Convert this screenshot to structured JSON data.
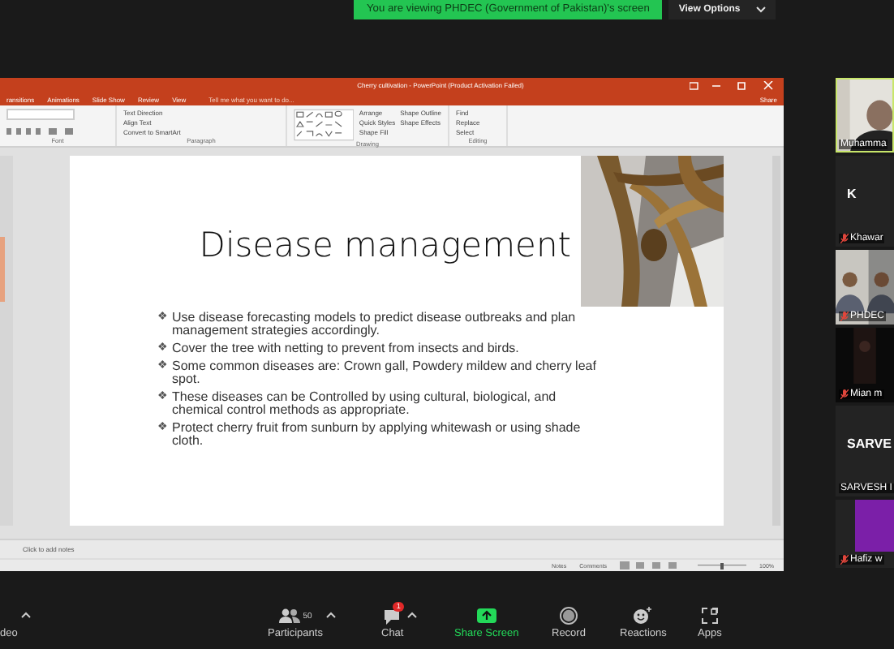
{
  "banner": {
    "text": "You are viewing PHDEC (Government of Pakistan)'s screen",
    "view_options": "View Options"
  },
  "powerpoint": {
    "title": "Cherry cultivation - PowerPoint (Product Activation Failed)",
    "tabs": [
      {
        "label": "ransitions",
        "selected": false
      },
      {
        "label": "Animations",
        "selected": false
      },
      {
        "label": "Slide Show",
        "selected": false
      },
      {
        "label": "Review",
        "selected": false
      },
      {
        "label": "View",
        "selected": false
      }
    ],
    "tell_me": "Tell me what you want to do...",
    "share": "Share",
    "ribbon_groups": [
      {
        "label": "Font"
      },
      {
        "label": "Paragraph",
        "commands": [
          "Text Direction",
          "Align Text",
          "Convert to SmartArt"
        ]
      },
      {
        "label": "Drawing",
        "commands": [
          "Arrange",
          "Quick Styles",
          "Shape Fill",
          "Shape Outline",
          "Shape Effects"
        ]
      },
      {
        "label": "Editing",
        "commands": [
          "Find",
          "Replace",
          "Select"
        ]
      }
    ],
    "slide": {
      "title": "Disease management",
      "bullet": "❖",
      "image": {
        "kind": "picture"
      },
      "bullets": [
        "Use disease forecasting models to predict disease outbreaks and plan management strategies accordingly.",
        "Cover the tree with netting to prevent from insects and birds.",
        "Some common diseases are: Crown gall, Powdery mildew and cherry leaf spot.",
        "These diseases can be Controlled by using cultural, biological, and chemical control methods as appropriate.",
        "Protect cherry fruit from sunburn by applying whitewash or using shade cloth."
      ]
    },
    "notes_placeholder": "Click to add notes",
    "status_bar": {
      "notes": "Notes",
      "comments": "Comments",
      "zoom_slider": {
        "level": 0.5
      },
      "zoom": "100%"
    }
  },
  "participants": [
    {
      "kind": "video",
      "name": "Muhamma",
      "muted": false,
      "speaking": true
    },
    {
      "kind": "name",
      "big_name": "K",
      "name": "Khawar",
      "muted": true,
      "speaking": false
    },
    {
      "kind": "video",
      "name": "PHDEC",
      "muted": true,
      "speaking": false
    },
    {
      "kind": "video",
      "name": "Mian m",
      "muted": true,
      "speaking": false
    },
    {
      "kind": "name",
      "big_name": "SARVE",
      "name": "SARVESH I",
      "muted": false,
      "speaking": false
    },
    {
      "kind": "avatar",
      "name": "Hafiz w",
      "muted": true,
      "speaking": false
    }
  ],
  "toolbar": [
    {
      "kind": "video",
      "label": "deo",
      "caret": true
    },
    {
      "kind": "participants",
      "label": "Participants",
      "count": "50",
      "caret": true
    },
    {
      "kind": "chat",
      "label": "Chat",
      "badge": "1",
      "caret": true
    },
    {
      "kind": "share",
      "label": "Share Screen",
      "caret": false
    },
    {
      "kind": "record",
      "label": "Record",
      "caret": false
    },
    {
      "kind": "reactions",
      "label": "Reactions",
      "caret": false
    },
    {
      "kind": "apps",
      "label": "Apps",
      "caret": false
    }
  ]
}
